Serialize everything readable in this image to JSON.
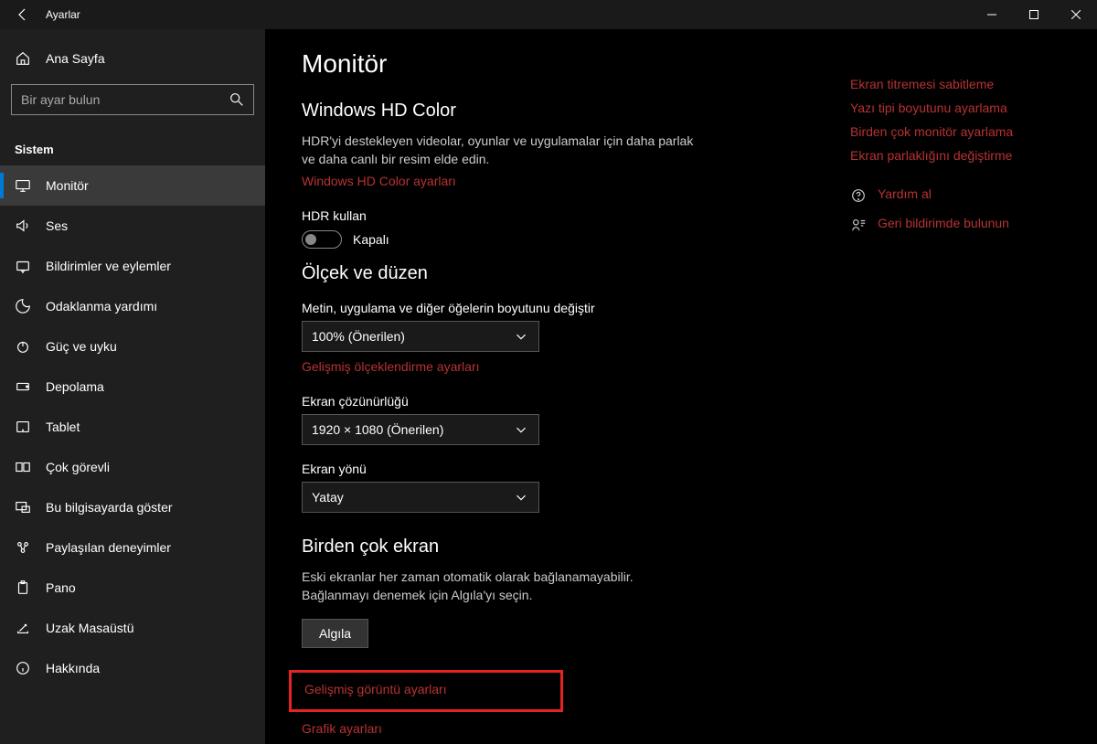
{
  "titlebar": {
    "title": "Ayarlar"
  },
  "sidebar": {
    "home": "Ana Sayfa",
    "search_placeholder": "Bir ayar bulun",
    "section": "Sistem",
    "items": [
      {
        "label": "Monitör",
        "icon": "monitor",
        "active": true
      },
      {
        "label": "Ses",
        "icon": "sound"
      },
      {
        "label": "Bildirimler ve eylemler",
        "icon": "notifications"
      },
      {
        "label": "Odaklanma yardımı",
        "icon": "focus"
      },
      {
        "label": "Güç ve uyku",
        "icon": "power"
      },
      {
        "label": "Depolama",
        "icon": "storage"
      },
      {
        "label": "Tablet",
        "icon": "tablet"
      },
      {
        "label": "Çok görevli",
        "icon": "multitask"
      },
      {
        "label": "Bu bilgisayarda göster",
        "icon": "project"
      },
      {
        "label": "Paylaşılan deneyimler",
        "icon": "shared"
      },
      {
        "label": "Pano",
        "icon": "clipboard"
      },
      {
        "label": "Uzak Masaüstü",
        "icon": "remote"
      },
      {
        "label": "Hakkında",
        "icon": "about"
      }
    ]
  },
  "main": {
    "page_title": "Monitör",
    "hdcolor": {
      "heading": "Windows HD Color",
      "desc": "HDR'yi destekleyen videolar, oyunlar ve uygulamalar için daha parlak ve daha canlı bir resim elde edin.",
      "link": "Windows HD Color ayarları",
      "hdr_label": "HDR kullan",
      "toggle_value": "Kapalı"
    },
    "scale": {
      "heading": "Ölçek ve düzen",
      "scale_label": "Metin, uygulama ve diğer öğelerin boyutunu değiştir",
      "scale_value": "100% (Önerilen)",
      "advanced_link": "Gelişmiş ölçeklendirme ayarları",
      "resolution_label": "Ekran çözünürlüğü",
      "resolution_value": "1920 × 1080 (Önerilen)",
      "orientation_label": "Ekran yönü",
      "orientation_value": "Yatay"
    },
    "multi": {
      "heading": "Birden çok ekran",
      "desc": "Eski ekranlar her zaman otomatik olarak bağlanamayabilir. Bağlanmayı denemek için Algıla'yı seçin.",
      "detect_btn": "Algıla",
      "advanced_display": "Gelişmiş görüntü ayarları",
      "graphics": "Grafik ayarları"
    }
  },
  "right": {
    "related": [
      "Ekran titremesi sabitleme",
      "Yazı tipi boyutunu ayarlama",
      "Birden çok monitör ayarlama",
      "Ekran parlaklığını değiştirme"
    ],
    "help": "Yardım al",
    "feedback": "Geri bildirimde bulunun"
  }
}
